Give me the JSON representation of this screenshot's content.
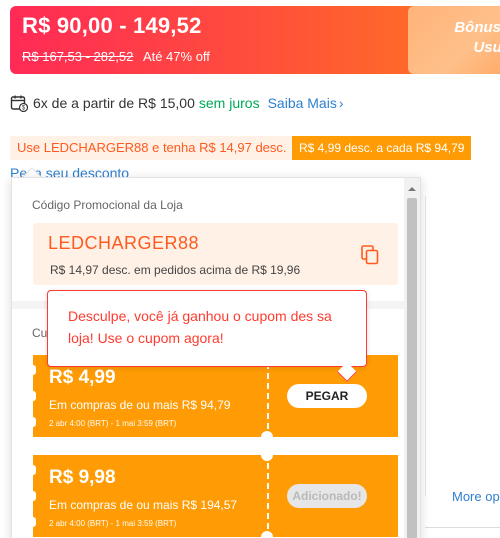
{
  "price": {
    "range": "R$ 90,00 - 149,52",
    "old_range": "R$ 167,53 - 282,52",
    "discount": "Até 47% off",
    "bonus_text": "Bônus N\nUsuár"
  },
  "installments": {
    "text": "6x de a partir de R$ 15,00",
    "interest": "sem juros",
    "link": "Saiba Mais"
  },
  "promos": {
    "chip_code": "Use LEDCHARGER88 e tenha R$ 14,97 desc.",
    "chip_tier": "R$ 4,99 desc. a cada R$ 94,79",
    "link_partial": "Peça seu desconto"
  },
  "dropdown": {
    "store_code_title": "Código Promocional da Loja",
    "code": "LEDCHARGER88",
    "code_sub": "R$ 14,97 desc. em pedidos acima de R$ 19,96",
    "coupons_title_partial": "Cu"
  },
  "tooltip": {
    "text": "Desculpe, você já ganhou o cupom des sa loja! Use o cupom agora!"
  },
  "coupons": [
    {
      "amount": "R$ 4,99",
      "condition": "Em compras de ou mais R$ 94,79",
      "dates": "2 abr 4:00 (BRT) - 1 mai 3:59 (BRT)",
      "button": "PEGAR"
    },
    {
      "amount": "R$ 9,98",
      "condition": "Em compras de ou mais R$ 194,57",
      "dates": "2 abr 4:00 (BRT) - 1 mai 3:59 (BRT)",
      "button": "Adicionado!"
    }
  ],
  "side": {
    "more_link": "More op"
  },
  "colors": {
    "banner_start": "#ff2a56",
    "banner_end": "#ff7a1d",
    "accent_orange": "#ff9c05",
    "promo_text": "#ff5a1f",
    "link": "#2e80d0",
    "success": "#00a85a",
    "tooltip_red": "#ff3b2f"
  },
  "icons": {
    "installment": "calendar-money-icon",
    "copy": "copy-icon",
    "chevron": "chevron-right-icon"
  }
}
